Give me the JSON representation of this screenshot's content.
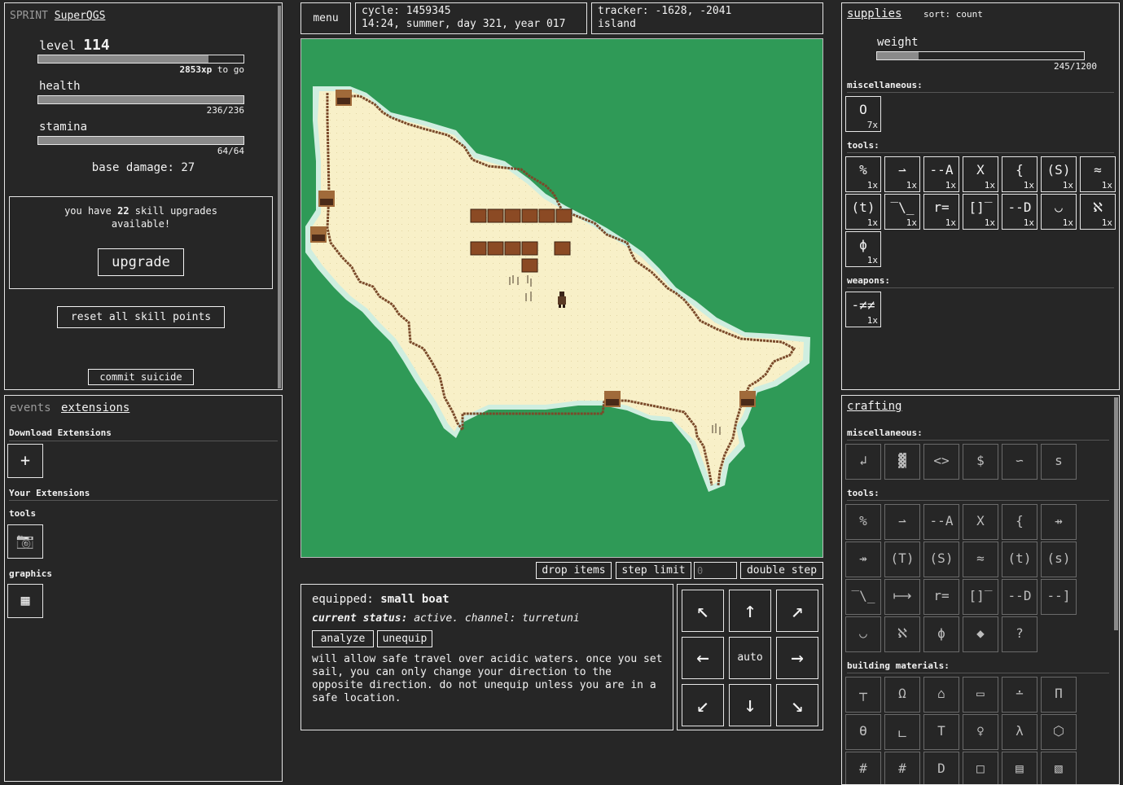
{
  "status_panel": {
    "mode": "SPRINT",
    "player_name": "SuperQGS",
    "level_label": "level",
    "level_value": "114",
    "xp_text": "2853xp",
    "xp_suffix": "to go",
    "xp_progress": 0.83,
    "health_label": "health",
    "health_value": "236/236",
    "health_progress": 1.0,
    "stamina_label": "stamina",
    "stamina_value": "64/64",
    "stamina_progress": 1.0,
    "base_damage_label": "base damage:",
    "base_damage_value": "27",
    "skill_text_pre": "you have",
    "skill_count": "22",
    "skill_text_post": "skill upgrades",
    "skill_text_line2": "available!",
    "upgrade_label": "upgrade",
    "reset_label": "reset all skill points",
    "suicide_label": "commit suicide"
  },
  "header": {
    "menu_label": "menu",
    "cycle_line": "cycle: 1459345",
    "time_line": "14:24, summer, day 321, year 017",
    "tracker_line": "tracker: -1628, -2041",
    "location_line": "island"
  },
  "map_controls": {
    "drop_label": "drop items",
    "step_limit_label": "step limit",
    "step_limit_placeholder": "0",
    "double_step_label": "double step"
  },
  "equip": {
    "equipped_label": "equipped:",
    "item_name": "small boat",
    "status_label": "current status:",
    "status_text": "active. channel: turretuni",
    "analyze_label": "analyze",
    "unequip_label": "unequip",
    "description": "will allow safe travel over acidic waters. once you set sail, you can only change your direction to the opposite direction. do not unequip unless you are in a safe location."
  },
  "movement": {
    "nw": "↖",
    "n": "↑",
    "ne": "↗",
    "w": "←",
    "auto": "auto",
    "e": "→",
    "sw": "↙",
    "s": "↓",
    "se": "↘"
  },
  "extensions": {
    "tab_events": "events",
    "tab_extensions": "extensions",
    "download_heading": "Download Extensions",
    "add_glyph": "+",
    "your_heading": "Your Extensions",
    "tools_heading": "tools",
    "graphics_heading": "graphics",
    "camera_glyph": "📷",
    "grid_glyph": "▦"
  },
  "supplies": {
    "title": "supplies",
    "sort_label": "sort:",
    "sort_value": "count",
    "weight_label": "weight",
    "weight_value": "245/1200",
    "weight_progress": 0.2,
    "misc_heading": "miscellaneous:",
    "tools_heading": "tools:",
    "weapons_heading": "weapons:",
    "misc_items": [
      {
        "glyph": "O",
        "count": "7x"
      }
    ],
    "tool_items": [
      {
        "glyph": "%",
        "count": "1x"
      },
      {
        "glyph": "⇀",
        "count": "1x"
      },
      {
        "glyph": "--A",
        "count": "1x"
      },
      {
        "glyph": "X",
        "count": "1x"
      },
      {
        "glyph": "{",
        "count": "1x"
      },
      {
        "glyph": "(S)",
        "count": "1x"
      },
      {
        "glyph": "≈",
        "count": "1x"
      },
      {
        "glyph": "(t)",
        "count": "1x"
      },
      {
        "glyph": "‾\\_",
        "count": "1x"
      },
      {
        "glyph": "r=",
        "count": "1x"
      },
      {
        "glyph": "[]‾",
        "count": "1x"
      },
      {
        "glyph": "--D",
        "count": "1x"
      },
      {
        "glyph": "◡",
        "count": "1x"
      },
      {
        "glyph": "ℵ",
        "count": "1x"
      },
      {
        "glyph": "ϕ",
        "count": "1x"
      }
    ],
    "weapon_items": [
      {
        "glyph": "-≠≠",
        "count": "1x"
      }
    ]
  },
  "crafting": {
    "title": "crafting",
    "misc_heading": "miscellaneous:",
    "tools_heading": "tools:",
    "building_heading": "building materials:",
    "misc_items": [
      "↲",
      "▓",
      "<>",
      "$",
      "∽",
      "s"
    ],
    "tool_items": [
      "%",
      "⇀",
      "--A",
      "X",
      "{",
      "⇸",
      "↠",
      "(T)",
      "(S)",
      "≈",
      "(t)",
      "(s)",
      "‾\\_",
      "⟼",
      "r=",
      "[]‾",
      "--D",
      "--]",
      "◡",
      "ℵ",
      "ϕ",
      "◆",
      "?"
    ],
    "building_items": [
      "┬",
      "Ω",
      "⌂",
      "▭",
      "∸",
      "Π",
      "ϴ",
      "ㄴ",
      "T",
      "♀",
      "λ",
      "⬡",
      "#",
      "#",
      "D",
      "□",
      "▤",
      "▧"
    ]
  },
  "colors": {
    "water": "#2f9a57",
    "sand": "#f8f0c8",
    "fence": "#7a4a2a",
    "background": "#262626"
  }
}
